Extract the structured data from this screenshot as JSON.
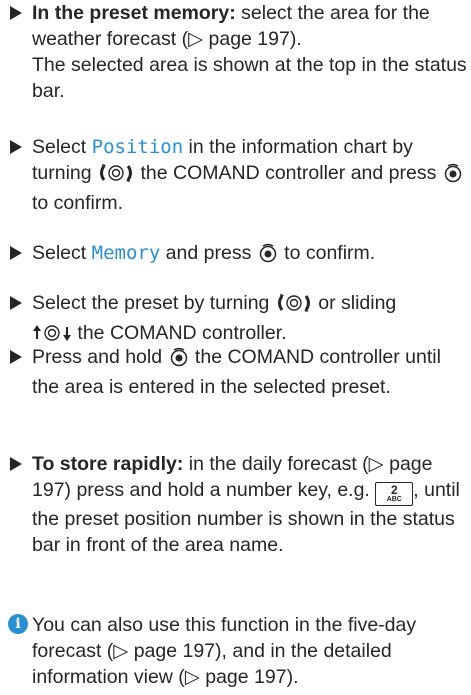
{
  "steps": [
    {
      "lead": "In the preset memory:",
      "text1": " select the area for the weather forecast (",
      "ref": "page 197",
      "text2": ").",
      "note": "The selected area is shown at the top in the status bar."
    },
    {
      "pre": "Select ",
      "keyword": "Position",
      "mid": " in the information chart by turning ",
      "mid2": " the COMAND controller and press ",
      "post": " to confirm."
    },
    {
      "pre": "Select ",
      "keyword": "Memory",
      "mid": " and press ",
      "post": " to confirm."
    },
    {
      "pre": "Select the preset by turning ",
      "mid": " or sliding ",
      "post": " the COMAND controller."
    },
    {
      "pre": "Press and hold ",
      "post": " the COMAND controller until the area is entered in the selected preset."
    },
    {
      "lead": "To store rapidly:",
      "text1": " in the daily forecast (",
      "ref": "page 197",
      "text2": ") press and hold a number key, e.g. ",
      "text3": ", until the preset position number is shown in the status bar in front of the area name.",
      "key_number": "2",
      "key_letters": "ABC"
    }
  ],
  "info": {
    "text1": " You can also use this function in the five-day forecast (",
    "ref1": "page 197",
    "text2": "), and in the detailed information view (",
    "ref2": "page 197",
    "text3": ")."
  },
  "icons": {
    "rotate": "turn-controller-icon",
    "press": "press-controller-icon",
    "slide": "slide-controller-icon",
    "info": "info-icon",
    "arrow": "page-reference-arrow"
  },
  "colors": {
    "keyword": "#2a8fd0",
    "info": "#2a8fd0",
    "text": "#262626"
  }
}
